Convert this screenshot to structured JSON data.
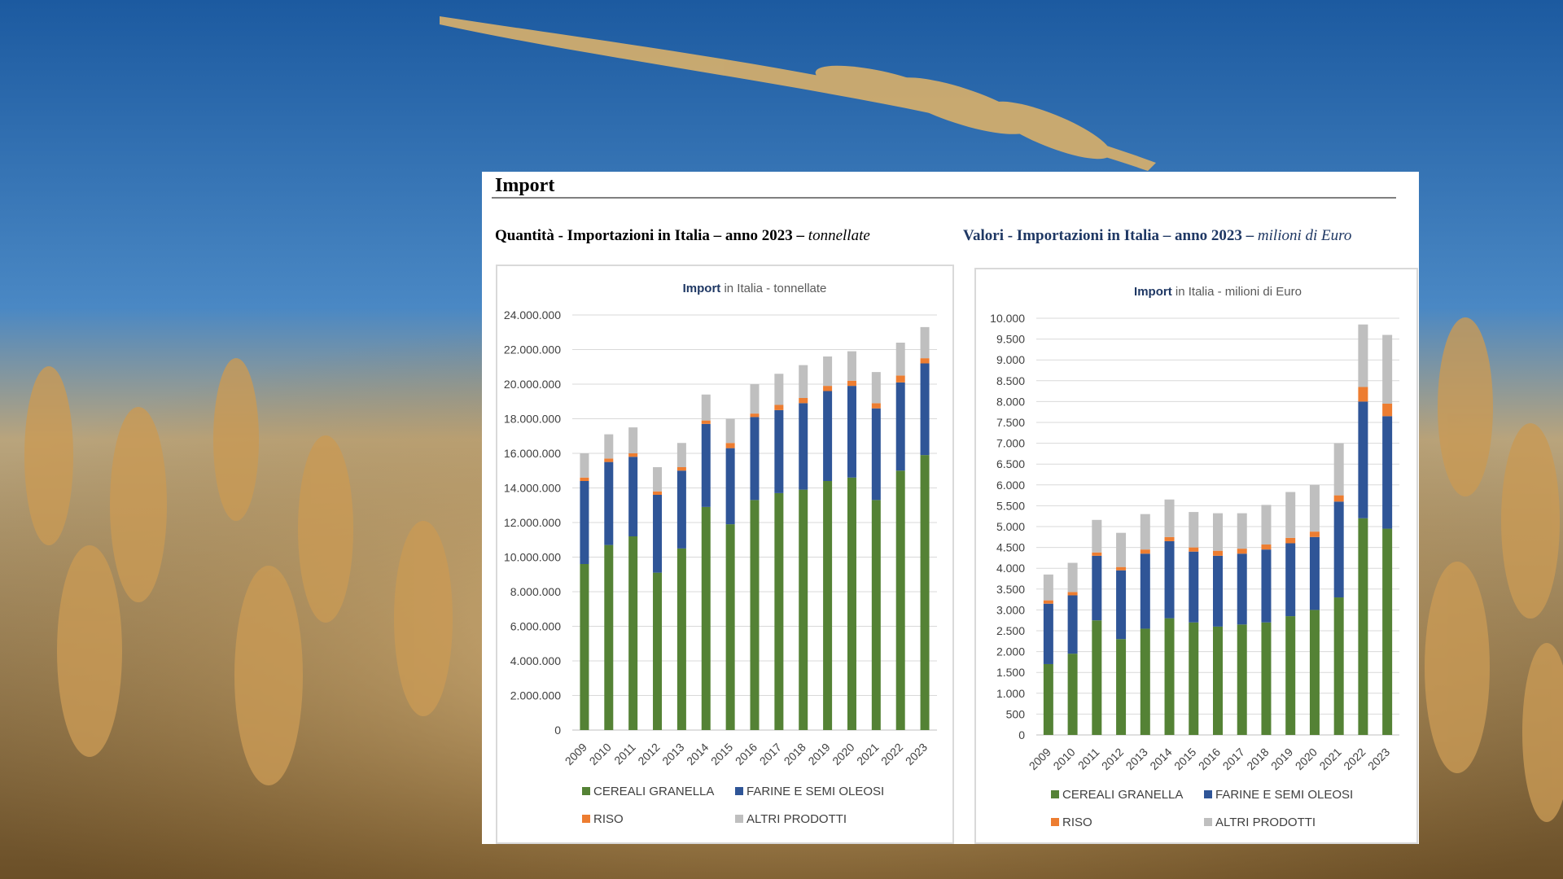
{
  "panel": {
    "title": "Import",
    "left_subtitle": {
      "main": "Quantità - Importazioni in Italia – anno 2023 – ",
      "unit": "tonnellate"
    },
    "right_subtitle": {
      "main": "Valori - Importazioni in Italia – anno 2023 – ",
      "unit": "milioni di Euro"
    }
  },
  "colors": {
    "cereali": "#548235",
    "farine": "#2f5597",
    "riso": "#ed7d31",
    "altri": "#bfbfbf",
    "grid": "#d9d9d9"
  },
  "chart_data": [
    {
      "type": "bar",
      "stacked": true,
      "title_bold": "Import",
      "title_rest": " in Italia - tonnellate",
      "categories": [
        "2009",
        "2010",
        "2011",
        "2012",
        "2013",
        "2014",
        "2015",
        "2016",
        "2017",
        "2018",
        "2019",
        "2020",
        "2021",
        "2022",
        "2023"
      ],
      "ylim": [
        0,
        24000000
      ],
      "yticks": [
        0,
        2000000,
        4000000,
        6000000,
        8000000,
        10000000,
        12000000,
        14000000,
        16000000,
        18000000,
        20000000,
        22000000,
        24000000
      ],
      "ytick_labels": [
        "0",
        "2.000.000",
        "4.000.000",
        "6.000.000",
        "8.000.000",
        "10.000.000",
        "12.000.000",
        "14.000.000",
        "16.000.000",
        "18.000.000",
        "20.000.000",
        "22.000.000",
        "24.000.000"
      ],
      "grid": true,
      "legend_position": "bottom",
      "series": [
        {
          "name": "CEREALI GRANELLA",
          "color_key": "cereali",
          "values": [
            9600000,
            10700000,
            11200000,
            9100000,
            10500000,
            12900000,
            11900000,
            13300000,
            13700000,
            13900000,
            14400000,
            14600000,
            13300000,
            15000000,
            15900000
          ]
        },
        {
          "name": "FARINE E SEMI OLEOSI",
          "color_key": "farine",
          "values": [
            4800000,
            4800000,
            4600000,
            4500000,
            4500000,
            4800000,
            4400000,
            4800000,
            4800000,
            5000000,
            5200000,
            5300000,
            5300000,
            5100000,
            5300000
          ]
        },
        {
          "name": "RISO",
          "color_key": "riso",
          "values": [
            200000,
            200000,
            200000,
            200000,
            200000,
            200000,
            300000,
            200000,
            300000,
            300000,
            300000,
            300000,
            300000,
            400000,
            300000
          ]
        },
        {
          "name": "ALTRI PRODOTTI",
          "color_key": "altri",
          "values": [
            1400000,
            1400000,
            1500000,
            1400000,
            1400000,
            1500000,
            1400000,
            1700000,
            1800000,
            1900000,
            1700000,
            1700000,
            1800000,
            1900000,
            1800000
          ]
        }
      ]
    },
    {
      "type": "bar",
      "stacked": true,
      "title_bold": "Import",
      "title_rest": " in Italia - milioni di Euro",
      "categories": [
        "2009",
        "2010",
        "2011",
        "2012",
        "2013",
        "2014",
        "2015",
        "2016",
        "2017",
        "2018",
        "2019",
        "2020",
        "2021",
        "2022",
        "2023"
      ],
      "ylim": [
        0,
        10000
      ],
      "yticks": [
        0,
        500,
        1000,
        1500,
        2000,
        2500,
        3000,
        3500,
        4000,
        4500,
        5000,
        5500,
        6000,
        6500,
        7000,
        7500,
        8000,
        8500,
        9000,
        9500,
        10000
      ],
      "ytick_labels": [
        "0",
        "500",
        "1.000",
        "1.500",
        "2.000",
        "2.500",
        "3.000",
        "3.500",
        "4.000",
        "4.500",
        "5.000",
        "5.500",
        "6.000",
        "6.500",
        "7.000",
        "7.500",
        "8.000",
        "8.500",
        "9.000",
        "9.500",
        "10.000"
      ],
      "grid": true,
      "legend_position": "bottom",
      "series": [
        {
          "name": "CEREALI GRANELLA",
          "color_key": "cereali",
          "values": [
            1700,
            1950,
            2750,
            2300,
            2550,
            2800,
            2700,
            2600,
            2650,
            2700,
            2850,
            3000,
            3300,
            5200,
            4950
          ]
        },
        {
          "name": "FARINE E SEMI OLEOSI",
          "color_key": "farine",
          "values": [
            1450,
            1400,
            1550,
            1650,
            1800,
            1850,
            1700,
            1700,
            1700,
            1750,
            1750,
            1750,
            2300,
            2800,
            2700
          ]
        },
        {
          "name": "RISO",
          "color_key": "riso",
          "values": [
            80,
            80,
            80,
            80,
            100,
            100,
            100,
            120,
            120,
            120,
            130,
            130,
            150,
            350,
            300
          ]
        },
        {
          "name": "ALTRI PRODOTTI",
          "color_key": "altri",
          "values": [
            620,
            700,
            780,
            820,
            850,
            900,
            850,
            900,
            850,
            950,
            1100,
            1120,
            1250,
            1500,
            1650
          ]
        }
      ]
    }
  ]
}
